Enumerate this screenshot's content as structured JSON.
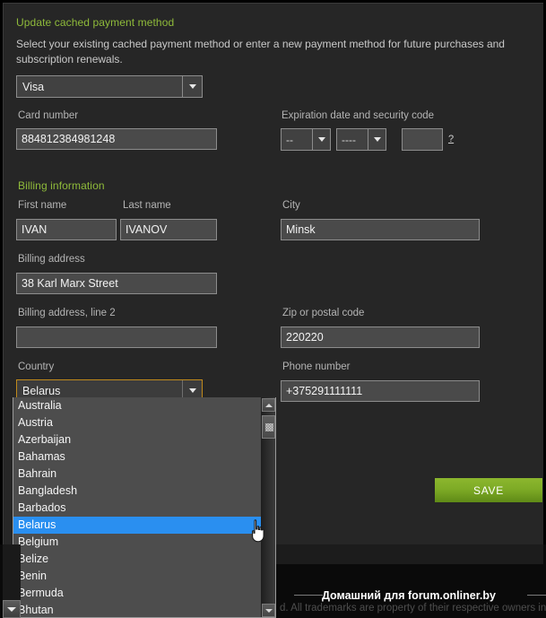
{
  "header": {
    "title": "Update cached payment method",
    "intro": "Select your existing cached payment method or enter a new payment method for future purchases and subscription renewals."
  },
  "payment_method": {
    "selected": "Visa",
    "caret_icon": "chevron-down-icon"
  },
  "card": {
    "number_label": "Card number",
    "number_value": "884812384981248",
    "expiry_label": "Expiration date and security code",
    "expiry_month": "--",
    "expiry_year": "----",
    "cvv_value": "",
    "cvv_help": "?"
  },
  "billing": {
    "section_title": "Billing information",
    "first_name_label": "First name",
    "first_name_value": "IVAN",
    "last_name_label": "Last name",
    "last_name_value": "IVANOV",
    "city_label": "City",
    "city_value": "Minsk",
    "address_label": "Billing address",
    "address_value": "38 Karl Marx Street",
    "address2_label": "Billing address, line 2",
    "address2_value": "",
    "zip_label": "Zip or postal code",
    "zip_value": "220220",
    "country_label": "Country",
    "country_value": "Belarus",
    "phone_label": "Phone number",
    "phone_value": "+375291111111"
  },
  "country_dropdown": {
    "selected": "Belarus",
    "options": [
      "Australia",
      "Austria",
      "Azerbaijan",
      "Bahamas",
      "Bahrain",
      "Bangladesh",
      "Barbados",
      "Belarus",
      "Belgium",
      "Belize",
      "Benin",
      "Bermuda",
      "Bhutan"
    ],
    "scroll_up_icon": "scroll-up-arrow-icon",
    "scroll_down_icon": "scroll-down-arrow-icon"
  },
  "actions": {
    "save_label": "SAVE"
  },
  "footer": {
    "watermark": "Домашний для forum.onliner.by",
    "legal": "d. All trademarks are property of their respective owners in t"
  },
  "colors": {
    "accent_green": "#8fbb3a",
    "save_green": "#7eab26",
    "highlight_blue": "#2a8ff0",
    "focus_border": "#c08a1c",
    "panel_bg": "#262626",
    "input_bg": "#4a4a4a"
  }
}
